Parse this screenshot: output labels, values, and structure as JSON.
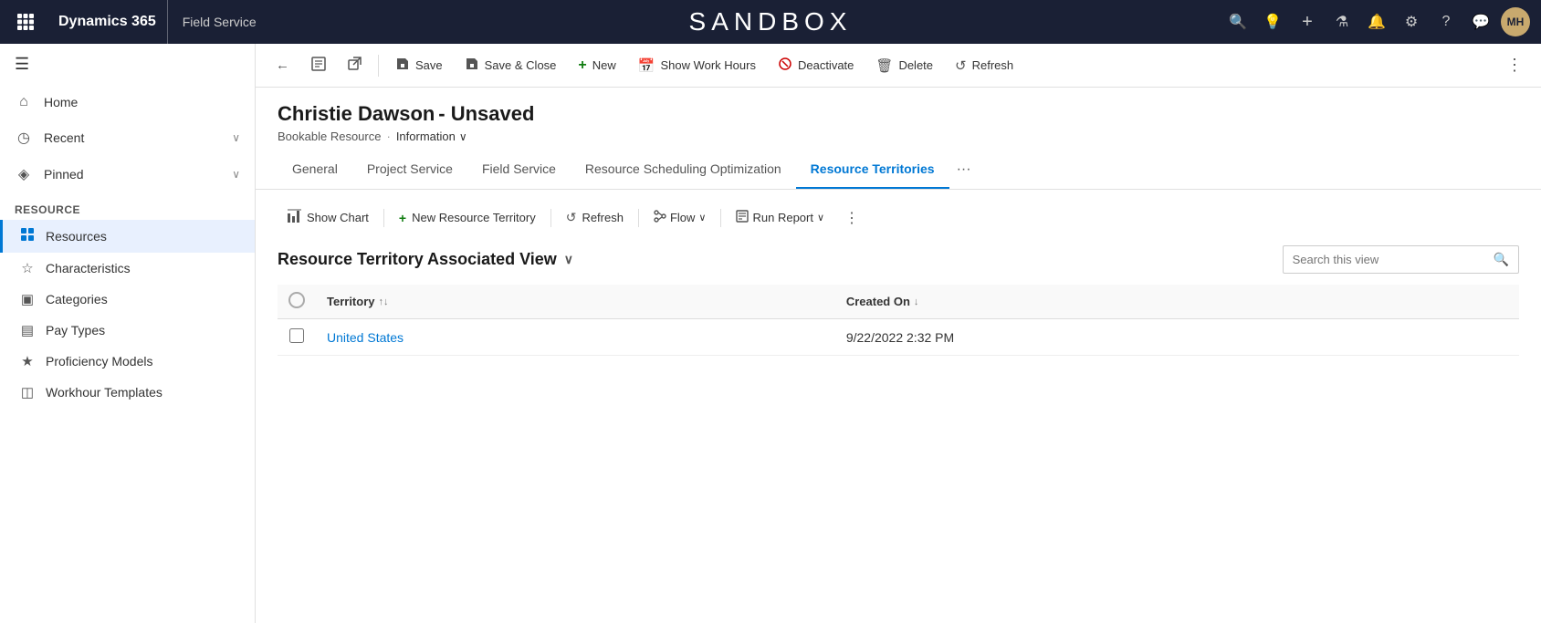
{
  "topNav": {
    "appTitle": "Dynamics 365",
    "moduleTitle": "Field Service",
    "sandboxLabel": "SANDBOX",
    "avatarInitials": "MH"
  },
  "sidebar": {
    "navItems": [
      {
        "id": "home",
        "icon": "⌂",
        "label": "Home"
      },
      {
        "id": "recent",
        "icon": "◷",
        "label": "Recent",
        "hasArrow": true
      },
      {
        "id": "pinned",
        "icon": "◈",
        "label": "Pinned",
        "hasArrow": true
      }
    ],
    "sectionLabel": "Resource",
    "subItems": [
      {
        "id": "resources",
        "icon": "▤",
        "label": "Resources",
        "active": true
      },
      {
        "id": "characteristics",
        "icon": "☆",
        "label": "Characteristics"
      },
      {
        "id": "categories",
        "icon": "▣",
        "label": "Categories"
      },
      {
        "id": "pay-types",
        "icon": "▤",
        "label": "Pay Types"
      },
      {
        "id": "proficiency-models",
        "icon": "★",
        "label": "Proficiency Models"
      },
      {
        "id": "workhour-templates",
        "icon": "◫",
        "label": "Workhour Templates"
      }
    ]
  },
  "commandBar": {
    "backBtn": "←",
    "saveBtn": "Save",
    "saveCloseBtn": "Save & Close",
    "newBtn": "New",
    "showWorkHoursBtn": "Show Work Hours",
    "deactivateBtn": "Deactivate",
    "deleteBtn": "Delete",
    "refreshBtn": "Refresh"
  },
  "record": {
    "title": "Christie Dawson",
    "unsavedLabel": "- Unsaved",
    "resourceType": "Bookable Resource",
    "separator": "·",
    "infoLabel": "Information",
    "tabs": [
      {
        "id": "general",
        "label": "General",
        "active": false
      },
      {
        "id": "project-service",
        "label": "Project Service",
        "active": false
      },
      {
        "id": "field-service",
        "label": "Field Service",
        "active": false
      },
      {
        "id": "resource-scheduling",
        "label": "Resource Scheduling Optimization",
        "active": false
      },
      {
        "id": "resource-territories",
        "label": "Resource Territories",
        "active": true
      }
    ]
  },
  "subgrid": {
    "showChartBtn": "Show Chart",
    "newResourceTerritoryBtn": "New Resource Territory",
    "refreshBtn": "Refresh",
    "flowBtn": "Flow",
    "runReportBtn": "Run Report",
    "viewTitle": "Resource Territory Associated View",
    "searchPlaceholder": "Search this view",
    "columns": [
      {
        "id": "territory",
        "label": "Territory",
        "sortable": true,
        "sortDirection": "asc"
      },
      {
        "id": "created-on",
        "label": "Created On",
        "sortable": true,
        "sortDirection": "desc"
      }
    ],
    "rows": [
      {
        "territory": "United States",
        "createdOn": "9/22/2022 2:32 PM"
      }
    ]
  }
}
